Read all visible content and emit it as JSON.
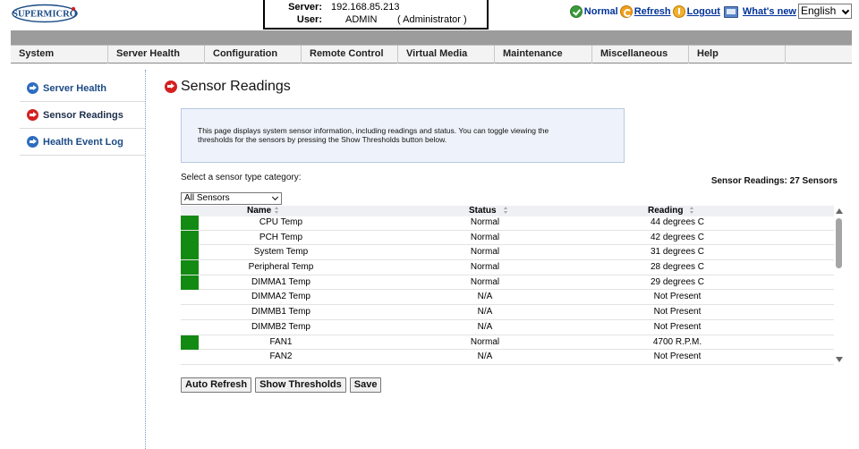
{
  "header": {
    "logo_text": "SUPERMICRO",
    "server_label": "Server:",
    "server_value": "192.168.85.213",
    "user_label": "User:",
    "user_value": "ADMIN",
    "user_role": "( Administrator )",
    "links": {
      "normal": "Normal",
      "refresh": "Refresh",
      "logout": "Logout",
      "whats_new": "What's new"
    },
    "language": "English"
  },
  "menu": [
    "System",
    "Server Health",
    "Configuration",
    "Remote Control",
    "Virtual Media",
    "Maintenance",
    "Miscellaneous",
    "Help"
  ],
  "sidebar": {
    "items": [
      {
        "label": "Server Health",
        "icon": "blue-arrow-icon"
      },
      {
        "label": "Sensor Readings",
        "icon": "red-arrow-icon",
        "active": true
      },
      {
        "label": "Health Event Log",
        "icon": "blue-arrow-icon"
      }
    ]
  },
  "main": {
    "title": "Sensor Readings",
    "info_line1": "This page displays system sensor information, including readings and status. You can toggle viewing the",
    "info_line2": "thresholds for the sensors by pressing the Show Thresholds button below.",
    "select_label": "Select a sensor type category:",
    "sensor_count": "Sensor Readings: 27 Sensors",
    "sensor_type": "All Sensors",
    "columns": {
      "name": "Name",
      "status": "Status",
      "reading": "Reading"
    },
    "rows": [
      {
        "name": "CPU Temp",
        "status": "Normal",
        "reading": "44 degrees C",
        "color": "#138a13"
      },
      {
        "name": "PCH Temp",
        "status": "Normal",
        "reading": "42 degrees C",
        "color": "#138a13"
      },
      {
        "name": "System Temp",
        "status": "Normal",
        "reading": "31 degrees C",
        "color": "#138a13"
      },
      {
        "name": "Peripheral Temp",
        "status": "Normal",
        "reading": "28 degrees C",
        "color": "#138a13"
      },
      {
        "name": "DIMMA1 Temp",
        "status": "Normal",
        "reading": "29 degrees C",
        "color": "#138a13"
      },
      {
        "name": "DIMMA2 Temp",
        "status": "N/A",
        "reading": "Not Present",
        "color": ""
      },
      {
        "name": "DIMMB1 Temp",
        "status": "N/A",
        "reading": "Not Present",
        "color": ""
      },
      {
        "name": "DIMMB2 Temp",
        "status": "N/A",
        "reading": "Not Present",
        "color": ""
      },
      {
        "name": "FAN1",
        "status": "Normal",
        "reading": "4700 R.P.M.",
        "color": "#138a13"
      },
      {
        "name": "FAN2",
        "status": "N/A",
        "reading": "Not Present",
        "color": ""
      }
    ],
    "buttons": {
      "auto_refresh": "Auto Refresh",
      "show_thresholds": "Show Thresholds",
      "save": "Save"
    }
  },
  "colors": {
    "normal_green": "#138a13",
    "accent_blue": "#1b4b86",
    "active_red": "#d42020"
  }
}
